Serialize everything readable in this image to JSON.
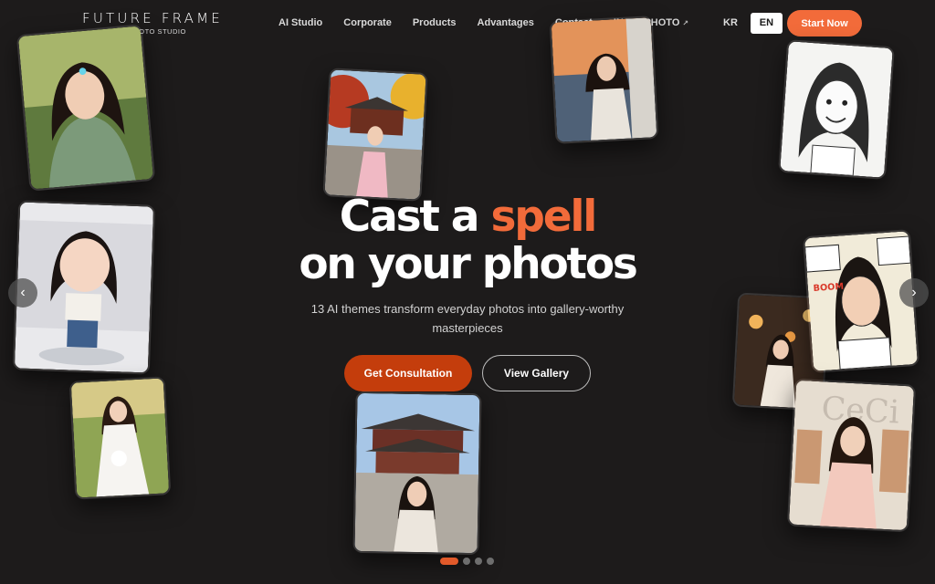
{
  "brand": {
    "title": "FUTURE FRAME",
    "subtitle": "AI PHOTO STUDIO"
  },
  "nav": {
    "items": [
      "AI Studio",
      "Corporate",
      "Products",
      "Advantages",
      "Contact",
      "INSSAPHOTO"
    ],
    "external_icon": "external-link-icon"
  },
  "language": {
    "options": [
      "KR",
      "EN"
    ],
    "selected": "EN"
  },
  "header_cta": "Start Now",
  "hero": {
    "line1_prefix": "Cast a ",
    "line1_accent": "spell",
    "line2": "on your photos",
    "description": "13 AI themes transform everyday photos into gallery-worthy masterpieces",
    "primary_button": "Get Consultation",
    "secondary_button": "View Gallery"
  },
  "carousel": {
    "slide_count": 4,
    "active_slide": 1,
    "prev_icon": "chevron-left-icon",
    "next_icon": "chevron-right-icon"
  },
  "colors": {
    "background": "#1d1b1b",
    "accent": "#f26b3a",
    "consult_button": "#c43d0c"
  }
}
